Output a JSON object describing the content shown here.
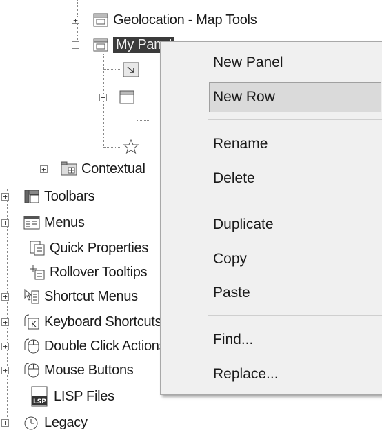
{
  "tree": {
    "geolocation": "Geolocation - Map Tools",
    "my_panel": "My Panel",
    "contextual": "Contextual",
    "toolbars": "Toolbars",
    "menus": "Menus",
    "quick_properties": "Quick Properties",
    "rollover": "Rollover Tooltips",
    "shortcut": "Shortcut Menus",
    "keyboard": "Keyboard Shortcuts",
    "double_click": "Double Click Actions",
    "mouse": "Mouse Buttons",
    "lisp": "LISP Files",
    "legacy": "Legacy"
  },
  "context_menu": {
    "new_panel": "New Panel",
    "new_row": "New Row",
    "rename": "Rename",
    "delete": "Delete",
    "duplicate": "Duplicate",
    "copy": "Copy",
    "paste": "Paste",
    "find": "Find...",
    "replace": "Replace..."
  }
}
